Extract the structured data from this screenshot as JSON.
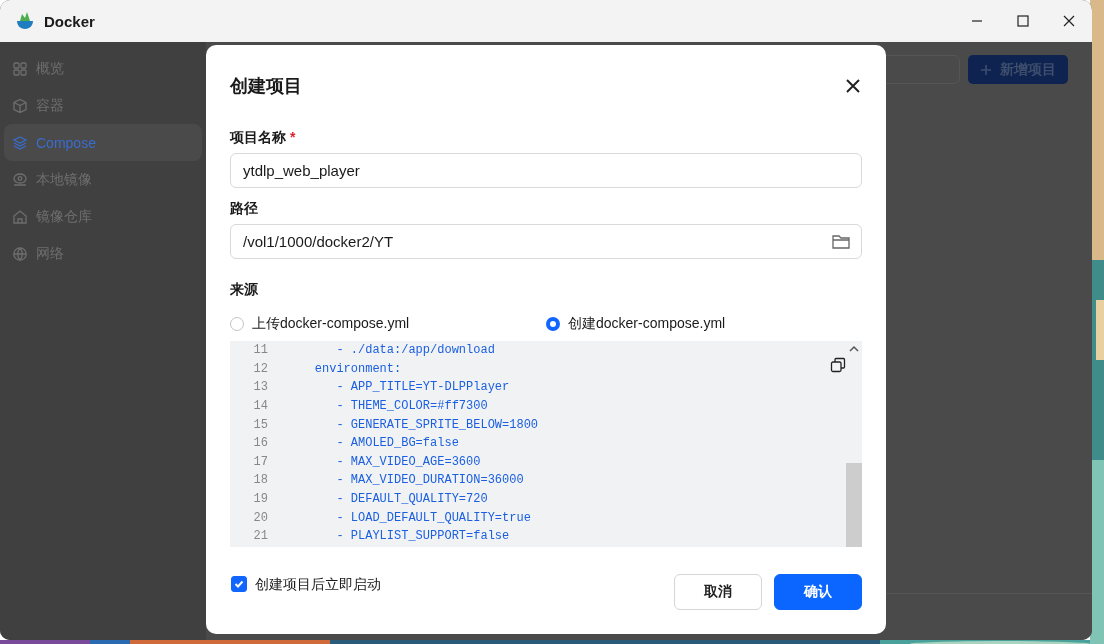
{
  "window": {
    "title": "Docker"
  },
  "sidebar": {
    "items": [
      {
        "label": "概览",
        "selected": false
      },
      {
        "label": "容器",
        "selected": false
      },
      {
        "label": "Compose",
        "selected": true
      },
      {
        "label": "本地镜像",
        "selected": false
      },
      {
        "label": "镜像仓库",
        "selected": false
      },
      {
        "label": "网络",
        "selected": false
      }
    ]
  },
  "toolbar": {
    "add_button": "新增项目"
  },
  "dialog": {
    "title": "创建项目",
    "fields": [
      {
        "label": "项目名称",
        "required_mark": "*",
        "value": "ytdlp_web_player",
        "kind": "text"
      },
      {
        "label": "路径",
        "value": "/vol1/1000/docker2/YT",
        "kind": "folder"
      }
    ],
    "source": {
      "label": "来源",
      "options": [
        {
          "label": "上传docker-compose.yml",
          "selected": false
        },
        {
          "label": "创建docker-compose.yml",
          "selected": true
        }
      ]
    },
    "editor": {
      "lines": [
        {
          "number": "11",
          "text": "       - ./data:/app/download"
        },
        {
          "number": "12",
          "text": "    environment:"
        },
        {
          "number": "13",
          "text": "       - APP_TITLE=YT-DLPPlayer"
        },
        {
          "number": "14",
          "text": "       - THEME_COLOR=#ff7300"
        },
        {
          "number": "15",
          "text": "       - GENERATE_SPRITE_BELOW=1800"
        },
        {
          "number": "16",
          "text": "       - AMOLED_BG=false"
        },
        {
          "number": "17",
          "text": "       - MAX_VIDEO_AGE=3600"
        },
        {
          "number": "18",
          "text": "       - MAX_VIDEO_DURATION=36000"
        },
        {
          "number": "19",
          "text": "       - DEFAULT_QUALITY=720"
        },
        {
          "number": "20",
          "text": "       - LOAD_DEFAULT_QUALITY=true"
        },
        {
          "number": "21",
          "text": "       - PLAYLIST_SUPPORT=false"
        }
      ]
    },
    "start_after_create": {
      "label": "创建项目后立即启动",
      "checked": true
    },
    "buttons": [
      {
        "label": "取消",
        "kind": "secondary"
      },
      {
        "label": "确认",
        "kind": "primary"
      }
    ]
  }
}
